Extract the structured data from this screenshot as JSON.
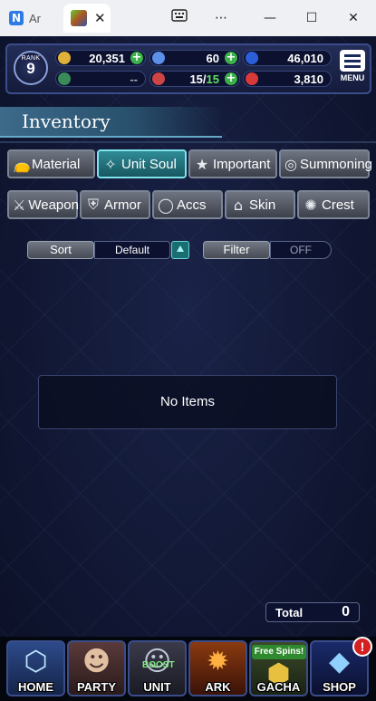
{
  "browser": {
    "inactive_tab_label": "Ar",
    "close_symbol": "✕",
    "window_buttons": [
      "keyboard-icon",
      "more-icon",
      "minimize-icon",
      "maximize-icon",
      "close-icon"
    ]
  },
  "hud": {
    "rank_label": "RANK",
    "rank_value": "9",
    "gil": "20,351",
    "crystal": "60",
    "gem": "46,010",
    "stamina_bar": "--",
    "energy_current": "15",
    "energy_sep": "/",
    "energy_max": "15",
    "red_gem": "3,810",
    "menu_label": "MENU"
  },
  "title": "Inventory",
  "categories_row1": [
    "Material",
    "Unit Soul",
    "Important",
    "Summoning"
  ],
  "categories_row2": [
    "Weapon",
    "Armor",
    "Accs",
    "Skin",
    "Crest"
  ],
  "active_category": "Unit Soul",
  "sort": {
    "label": "Sort",
    "value": "Default"
  },
  "filter": {
    "label": "Filter",
    "value": "OFF"
  },
  "empty_message": "No Items",
  "total": {
    "label": "Total",
    "value": "0"
  },
  "nav": {
    "home": "HOME",
    "party": "PARTY",
    "unit": "UNIT",
    "unit_tag": "BOOST",
    "ark": "ARK",
    "gacha": "GACHA",
    "gacha_tag": "Free Spins!",
    "shop": "SHOP",
    "shop_badge": "!"
  },
  "colors": {
    "active_tab": "#2f8c97",
    "background": "#111733",
    "plus_button": "#3cb04a",
    "badge": "#d42020"
  }
}
